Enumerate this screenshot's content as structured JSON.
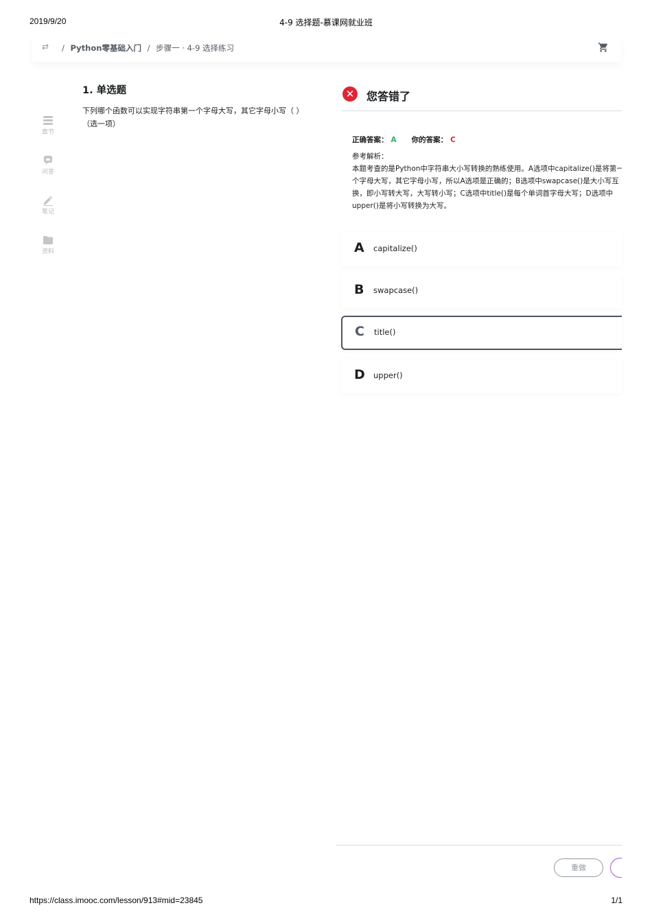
{
  "print": {
    "date": "2019/9/20",
    "title": "4-9 选择题-慕课网就业班",
    "url": "https://class.imooc.com/lesson/913#mid=23845",
    "page": "1/1"
  },
  "breadcrumb": {
    "course": "Python零基础入门",
    "current": "步骤一 · 4-9 选择练习"
  },
  "sidebar": {
    "items": [
      {
        "label": "章节",
        "icon": "chapter-icon"
      },
      {
        "label": "问答",
        "icon": "qa-icon"
      },
      {
        "label": "笔记",
        "icon": "note-icon"
      },
      {
        "label": "资料",
        "icon": "folder-icon"
      }
    ]
  },
  "question": {
    "title": "1. 单选题",
    "text": "下列哪个函数可以实现字符串第一个字母大写，其它字母小写（ ）（选一项）"
  },
  "result": {
    "icon": "wrong-icon",
    "title": "您答错了",
    "correct_label": "正确答案：",
    "correct_value": "A",
    "yours_label": "你的答案：",
    "yours_value": "C",
    "analysis_label": "参考解析：",
    "analysis_text": "本题考查的是Python中字符串大小写转换的熟练使用。A选项中capitalize()是将第一个字母大写，其它字母小写，所以A选项是正确的；B选项中swapcase()是大小写互换，即小写转大写，大写转小写；C选项中title()是每个单词首字母大写；D选项中upper()是将小写转换为大写。"
  },
  "options": [
    {
      "letter": "A",
      "text": "capitalize()"
    },
    {
      "letter": "B",
      "text": "swapcase()"
    },
    {
      "letter": "C",
      "text": "title()"
    },
    {
      "letter": "D",
      "text": "upper()"
    }
  ],
  "footer": {
    "redo_label": "重做"
  },
  "colors": {
    "correct": "#2cae66",
    "wrong": "#e02433",
    "next_border": "#a254d8"
  }
}
